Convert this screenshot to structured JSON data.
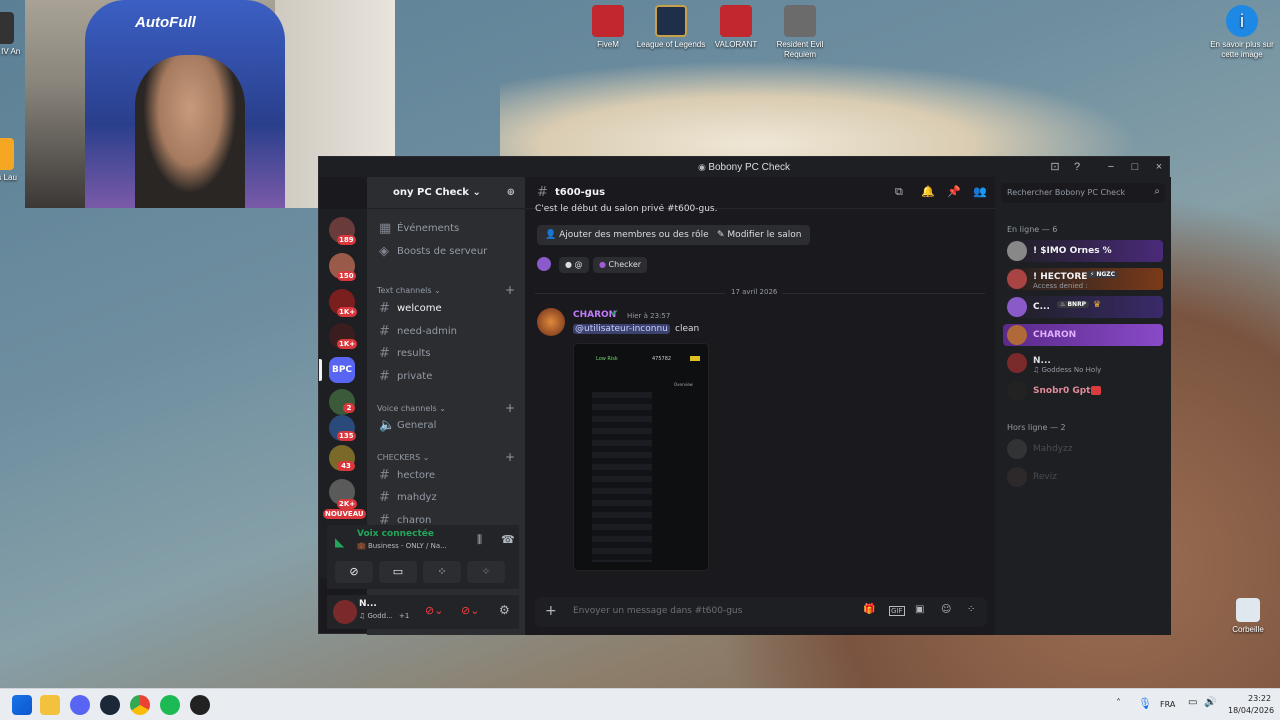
{
  "desktop": {
    "icons": [
      {
        "label": "FiveM",
        "color": "#c1272d"
      },
      {
        "label": "League of Legends",
        "color": "#1f2f4a"
      },
      {
        "label": "VALORANT",
        "color": "#c1272d"
      },
      {
        "label": "Resident Evil Requiem",
        "color": "#6b6b6b"
      },
      {
        "label": "En savoir plus sur cette image",
        "color": "#1e88e5"
      },
      {
        "label": "Corbeille",
        "color": "#3b7dd8"
      }
    ],
    "left_clipped": [
      "Age of IV An",
      "Rocks Lau"
    ],
    "webcam_chair_text": "AutoFull"
  },
  "window": {
    "title": "Bobony PC Check",
    "controls": [
      "−",
      "□",
      "×"
    ]
  },
  "guilds": [
    {
      "badge": "189",
      "color": "#6a3b3b"
    },
    {
      "badge": "150",
      "color": "#9a5a4a"
    },
    {
      "badge": "1K+",
      "color": "#7a1e1e"
    },
    {
      "badge": "1K+",
      "color": "#3a1e1e"
    },
    {
      "badge": "",
      "label": "BPC",
      "color": "#5865f2"
    },
    {
      "badge": "2",
      "color": "#3a5a3a"
    },
    {
      "badge": "135",
      "color": "#2a4a7a"
    },
    {
      "badge": "43",
      "color": "#7a6a2a"
    },
    {
      "badge": "2K+",
      "color": "#5a5a5a"
    }
  ],
  "guild_new_label": "NOUVEAU",
  "sidebar": {
    "server_name": "ony PC Check",
    "top_items": [
      {
        "icon": "calendar-icon",
        "label": "Événements"
      },
      {
        "icon": "boost-icon",
        "label": "Boosts de serveur"
      }
    ],
    "text_category": "Text channels",
    "text_channels": [
      "welcome",
      "need-admin",
      "results",
      "private"
    ],
    "voice_category": "Voice channels",
    "voice_channels": [
      "General"
    ],
    "checkers_category": "CHECKERS",
    "checker_channels": [
      "hectore",
      "mahdyz",
      "charon"
    ],
    "voice_status": {
      "title": "Voix connectée",
      "channel": "💼 Business - ONLY / Na..."
    },
    "user": {
      "name": "N...",
      "status": "♫ Godd...",
      "extra": "+1"
    }
  },
  "main": {
    "channel": "t600-gus",
    "intro": "C'est le début du salon privé #t600-gus.",
    "buttons": {
      "add_members": "Ajouter des membres ou des rôles",
      "edit_channel": "Modifier le salon"
    },
    "role_tag": "Checker",
    "role_tag_prefix": "@",
    "date_divider": "17 avril 2026",
    "message": {
      "author": "CHARON",
      "time": "Hier à 23:57",
      "mention": "@utilisateur-inconnu",
      "text": "clean"
    },
    "screenshot_labels": {
      "risk": "Low Risk",
      "id": "475782",
      "overview": "Overview"
    },
    "composer_placeholder": "Envoyer un message dans #t600-gus",
    "search_placeholder": "Rechercher Bobony PC Check"
  },
  "members": {
    "online_header": "En ligne — 6",
    "online": [
      {
        "name": "! $IMO Ornes %",
        "sub": "",
        "color": "#f2f3f5",
        "bg": "#3a2a5a",
        "avatar": "#888"
      },
      {
        "name": "! HECTORE",
        "tag": "NGZC",
        "sub": "Access denied :",
        "color": "#f2f3f5",
        "bg": "#5a2a1a",
        "avatar": "#a44"
      },
      {
        "name": "C...",
        "tag": "BNRP",
        "sub": "",
        "color": "#f2f3f5",
        "bg": "#3a2a6a",
        "avatar": "#8a5ac8"
      },
      {
        "name": "CHARON",
        "sub": "",
        "color": "#e0b0ff",
        "bg": "#5a2a8a",
        "avatar": "#b06a3a"
      },
      {
        "name": "N...",
        "sub": "♫ Goddess No Holy",
        "color": "#dbdee1",
        "bg": "",
        "avatar": "#7a2a2a"
      },
      {
        "name": "Snobr0 Gpt",
        "sub": "",
        "color": "#e08a9a",
        "bg": "",
        "avatar": "#222"
      }
    ],
    "offline_header": "Hors ligne — 2",
    "offline": [
      {
        "name": "Mahdyzz",
        "avatar": "#5a5a5a"
      },
      {
        "name": "Reviz",
        "avatar": "#4a3a3a"
      }
    ]
  },
  "taskbar": {
    "lang": "FRA",
    "time": "23:22",
    "date": "18/04/2026"
  }
}
